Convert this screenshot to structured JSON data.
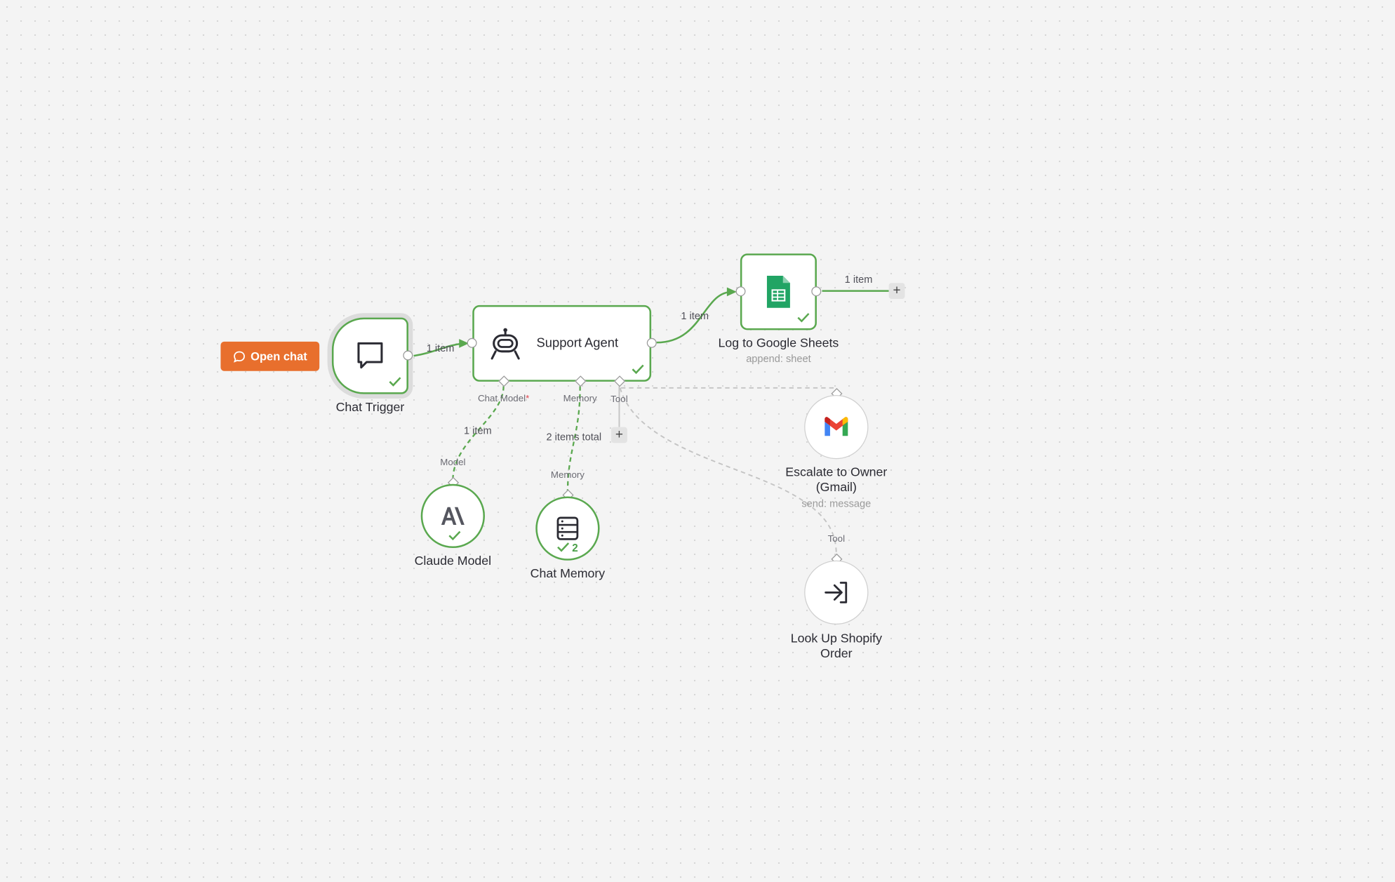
{
  "open_chat": {
    "label": "Open chat",
    "icon": "chat-bubble-icon"
  },
  "colors": {
    "success": "#5aa84f",
    "accent": "#e86f2d",
    "edge_inactive": "#c4c4c4",
    "required": "#e0444e"
  },
  "nodes": {
    "chat_trigger": {
      "label": "Chat Trigger",
      "icon": "chat-icon",
      "status": "success"
    },
    "support_agent": {
      "label": "Support Agent",
      "icon": "robot-icon",
      "status": "success"
    },
    "google_sheets": {
      "label": "Log to Google Sheets",
      "subtitle": "append: sheet",
      "icon": "google-sheets-icon",
      "status": "success"
    },
    "claude_model": {
      "label": "Claude Model",
      "icon": "anthropic-icon",
      "status": "success"
    },
    "chat_memory": {
      "label": "Chat Memory",
      "icon": "database-icon",
      "status": "success",
      "run_count": "2"
    },
    "gmail": {
      "label_line1": "Escalate to Owner",
      "label_line2": "(Gmail)",
      "subtitle": "send: message",
      "icon": "gmail-icon"
    },
    "shopify": {
      "label_line1": "Look Up Shopify",
      "label_line2": "Order",
      "icon": "sign-in-arrow-icon"
    }
  },
  "edges": {
    "trigger_to_agent": "1 item",
    "agent_to_sheets": "1 item",
    "sheets_out": "1 item",
    "model_link": "1 item",
    "memory_link": "2 items total"
  },
  "ports": {
    "chat_model": "Chat Model",
    "chat_model_required": "*",
    "memory": "Memory",
    "tool": "Tool",
    "model_in": "Model",
    "memory_in": "Memory",
    "tool_in": "Tool"
  },
  "add_symbol": "+"
}
